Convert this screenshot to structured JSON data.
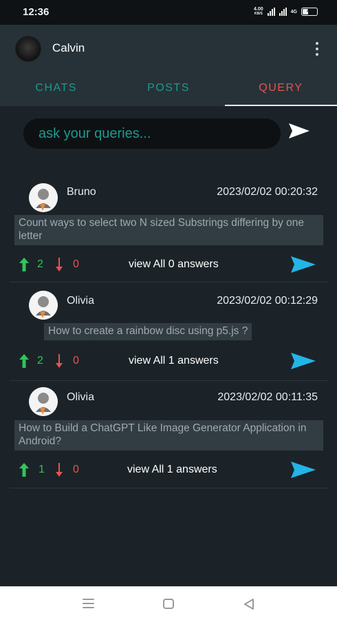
{
  "status_bar": {
    "time": "12:36",
    "net_speed_value": "4.00",
    "net_speed_unit": "KB/S",
    "network_label": "4G",
    "battery_level": "44"
  },
  "header": {
    "user_name": "Calvin"
  },
  "tabs": [
    {
      "label": "CHATS",
      "active": false
    },
    {
      "label": "POSTS",
      "active": false
    },
    {
      "label": "QUERY",
      "active": true
    }
  ],
  "search": {
    "placeholder": "ask your queries..."
  },
  "posts": [
    {
      "user": "Bruno",
      "timestamp": "2023/02/02 00:20:32",
      "question": "Count ways to select two N sized Substrings differing by one letter",
      "upvotes": "2",
      "downvotes": "0",
      "answers_label": "view All 0 answers"
    },
    {
      "user": "Olivia",
      "timestamp": "2023/02/02 00:12:29",
      "question": "How to create a rainbow disc using p5.js ?",
      "upvotes": "2",
      "downvotes": "0",
      "answers_label": "view All 1 answers"
    },
    {
      "user": "Olivia",
      "timestamp": "2023/02/02 00:11:35",
      "question": "How to Build a ChatGPT Like Image Generator Application in Android?",
      "upvotes": "1",
      "downvotes": "0",
      "answers_label": "view All 1 answers"
    }
  ],
  "colors": {
    "accent_teal": "#1f9a8a",
    "active_tab_red": "#e8534f",
    "send_blue": "#22b5e6",
    "upvote_green": "#31c45a",
    "downvote_red": "#e8534f"
  },
  "icons": {
    "send": "send-icon",
    "upvote": "arrow-up-icon",
    "downvote": "arrow-down-icon",
    "menu": "kebab-menu-icon"
  }
}
